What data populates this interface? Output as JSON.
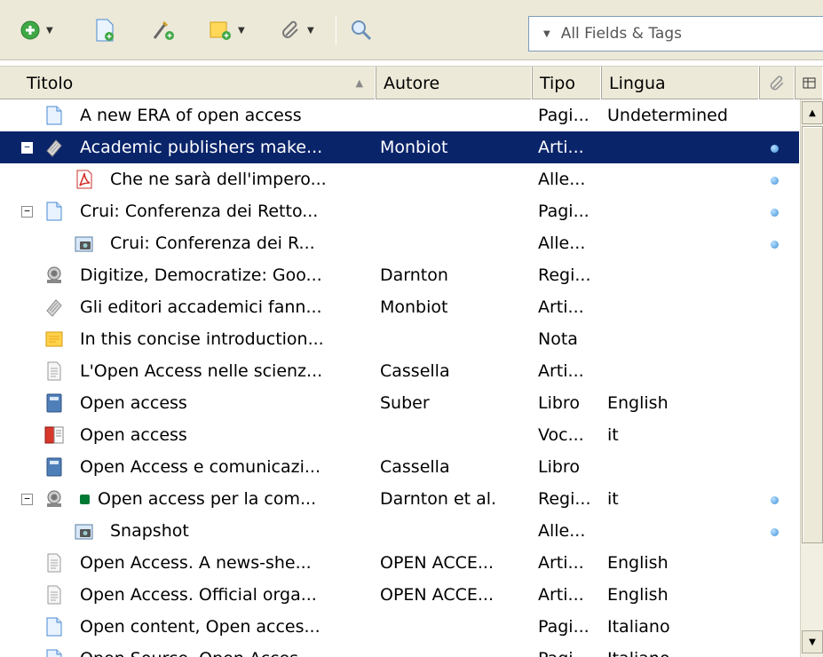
{
  "toolbar": {
    "buttons": [
      {
        "icon": "new-item-icon",
        "has_menu": true
      },
      {
        "icon": "new-from-file-icon",
        "has_menu": false
      },
      {
        "icon": "add-by-identifier-icon",
        "has_menu": false
      },
      {
        "icon": "new-note-icon",
        "has_menu": true
      },
      {
        "icon": "attachment-icon",
        "has_menu": true
      },
      {
        "icon": "search-icon",
        "has_menu": false
      }
    ],
    "search": {
      "mode_label": "All Fields & Tags",
      "value": ""
    }
  },
  "columns": {
    "title": "Titolo",
    "author": "Autore",
    "type": "Tipo",
    "language": "Lingua"
  },
  "rows": [
    {
      "title": "A new ERA of open access",
      "author": "",
      "type": "Pagi...",
      "lang": "Undetermined",
      "icon": "webpage-icon",
      "level": 1,
      "twisty": "",
      "attachment": false
    },
    {
      "title": "Academic publishers make...",
      "author": "Monbiot",
      "type": "Arti...",
      "lang": "",
      "icon": "newspaper-article-icon",
      "level": 1,
      "twisty": "−",
      "attachment": true,
      "selected": true
    },
    {
      "title": "Che ne sarà dell'impero...",
      "author": "",
      "type": "Alle...",
      "lang": "",
      "icon": "pdf-icon",
      "level": 2,
      "twisty": "",
      "attachment": true
    },
    {
      "title": "Crui: Conferenza dei Retto...",
      "author": "",
      "type": "Pagi...",
      "lang": "",
      "icon": "webpage-icon",
      "level": 1,
      "twisty": "−",
      "attachment": true
    },
    {
      "title": "Crui: Conferenza dei R...",
      "author": "",
      "type": "Alle...",
      "lang": "",
      "icon": "snapshot-icon",
      "level": 2,
      "twisty": "",
      "attachment": true
    },
    {
      "title": "Digitize, Democratize: Goo...",
      "author": "Darnton",
      "type": "Regi...",
      "lang": "",
      "icon": "recording-icon",
      "level": 1,
      "twisty": "",
      "attachment": false
    },
    {
      "title": "Gli editori accademici fann...",
      "author": "Monbiot",
      "type": "Arti...",
      "lang": "",
      "icon": "newspaper-article-icon",
      "level": 1,
      "twisty": "",
      "attachment": false
    },
    {
      "title": "In this concise introduction...",
      "author": "",
      "type": "Nota",
      "lang": "",
      "icon": "note-icon",
      "level": 1,
      "twisty": "",
      "attachment": false
    },
    {
      "title": "L'Open Access nelle scienz...",
      "author": "Cassella",
      "type": "Arti...",
      "lang": "",
      "icon": "journal-article-icon",
      "level": 1,
      "twisty": "",
      "attachment": false
    },
    {
      "title": "Open access",
      "author": "Suber",
      "type": "Libro",
      "lang": "English",
      "icon": "book-icon",
      "level": 1,
      "twisty": "",
      "attachment": false
    },
    {
      "title": "Open access",
      "author": "",
      "type": "Voc...",
      "lang": "it",
      "icon": "encyclopedia-icon",
      "level": 1,
      "twisty": "",
      "attachment": false
    },
    {
      "title": "Open Access e comunicazi...",
      "author": "Cassella",
      "type": "Libro",
      "lang": "",
      "icon": "book-icon",
      "level": 1,
      "twisty": "",
      "attachment": false
    },
    {
      "title": "Open access per la com...",
      "author": "Darnton et al.",
      "type": "Regi...",
      "lang": "it",
      "icon": "recording-icon",
      "level": 1,
      "twisty": "−",
      "attachment": true,
      "tag_color": "#007a33"
    },
    {
      "title": "Snapshot",
      "author": "",
      "type": "Alle...",
      "lang": "",
      "icon": "snapshot-icon",
      "level": 2,
      "twisty": "",
      "attachment": true
    },
    {
      "title": "Open Access. A news-she...",
      "author": "OPEN ACCE...",
      "type": "Arti...",
      "lang": "English",
      "icon": "journal-article-icon",
      "level": 1,
      "twisty": "",
      "attachment": false
    },
    {
      "title": "Open Access. Official orga...",
      "author": "OPEN ACCE...",
      "type": "Arti...",
      "lang": "English",
      "icon": "journal-article-icon",
      "level": 1,
      "twisty": "",
      "attachment": false
    },
    {
      "title": "Open content, Open acces...",
      "author": "",
      "type": "Pagi...",
      "lang": "Italiano",
      "icon": "webpage-icon",
      "level": 1,
      "twisty": "",
      "attachment": false
    },
    {
      "title": "Open Source, Open Acces...",
      "author": "",
      "type": "Pagi...",
      "lang": "Italiano",
      "icon": "webpage-icon",
      "level": 1,
      "twisty": "",
      "attachment": false
    }
  ],
  "colors": {
    "selection": "#0a246a",
    "chrome": "#ece9d8",
    "attachment_dot": "#3a8ed8"
  }
}
